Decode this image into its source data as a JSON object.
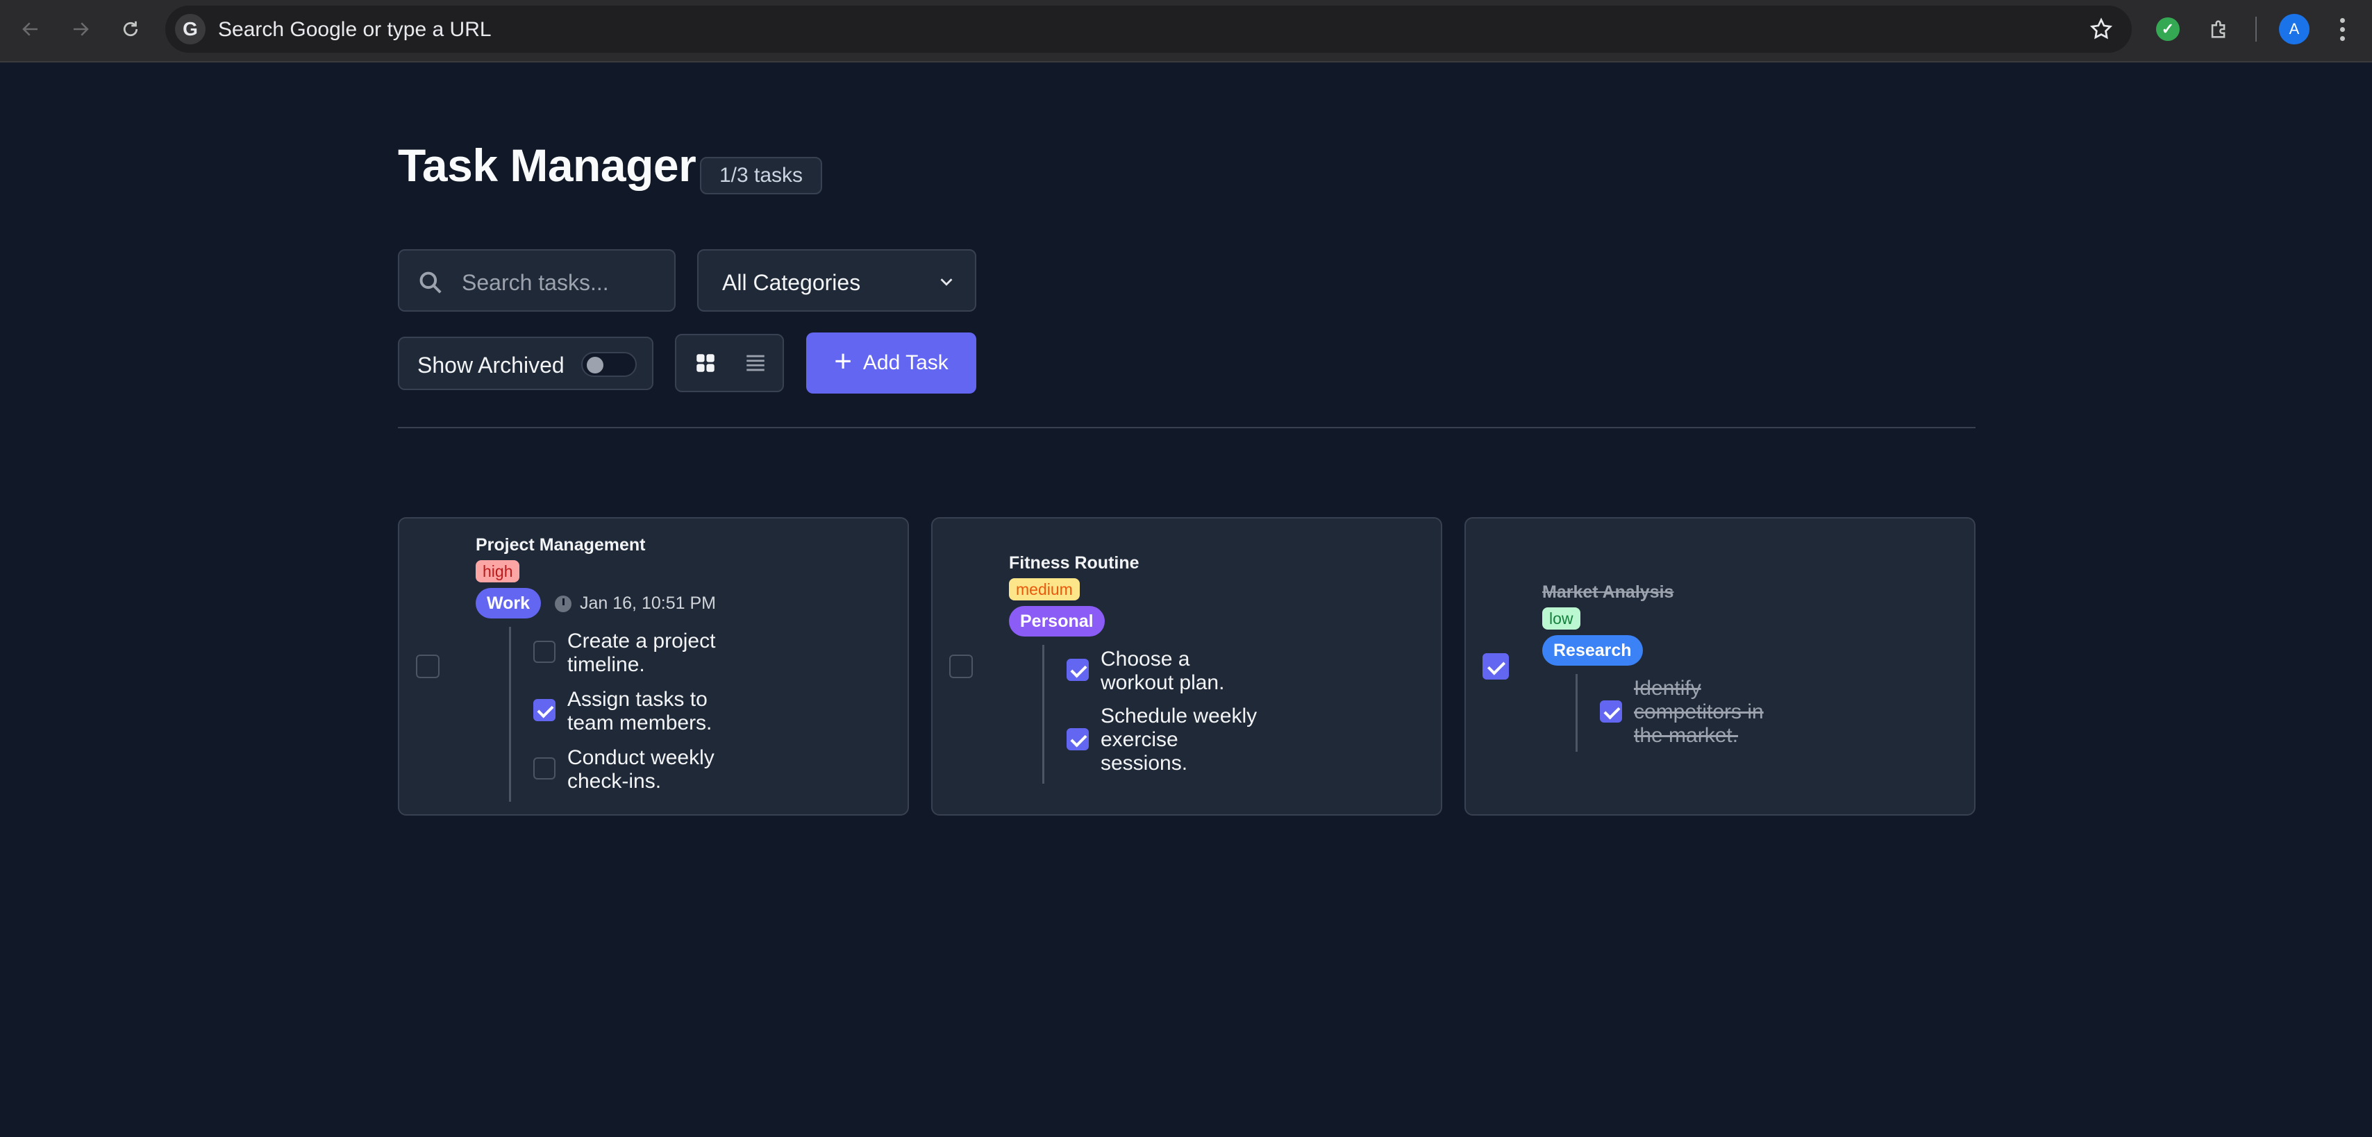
{
  "browser": {
    "url_placeholder": "Search Google or type a URL",
    "google_letter": "G",
    "extension_check": "✓",
    "profile_initial": "A"
  },
  "header": {
    "title": "Task Manager",
    "count": "1/3 tasks"
  },
  "controls": {
    "search_placeholder": "Search tasks...",
    "category_selected": "All Categories",
    "show_archived_label": "Show Archived",
    "show_archived_on": false,
    "view_mode": "grid",
    "add_task_label": "Add Task"
  },
  "tasks": [
    {
      "title": "Project Management",
      "priority": "high",
      "category": "Work",
      "due": "Jan 16, 10:51 PM",
      "completed": false,
      "subtasks": [
        {
          "text": "Create a project timeline.",
          "done": false
        },
        {
          "text": "Assign tasks to team members.",
          "done": true
        },
        {
          "text": "Conduct weekly check-ins.",
          "done": false
        }
      ]
    },
    {
      "title": "Fitness Routine",
      "priority": "medium",
      "category": "Personal",
      "completed": false,
      "subtasks": [
        {
          "text": "Choose a workout plan.",
          "done": true
        },
        {
          "text": "Schedule weekly exercise sessions.",
          "done": true
        }
      ]
    },
    {
      "title": "Market Analysis",
      "priority": "low",
      "category": "Research",
      "completed": true,
      "subtasks": [
        {
          "text": "Identify competitors in the market.",
          "done": true
        }
      ]
    }
  ],
  "colors": {
    "accent": "#6366f1",
    "background": "#111827",
    "card": "#1f2937",
    "border": "#374151"
  }
}
